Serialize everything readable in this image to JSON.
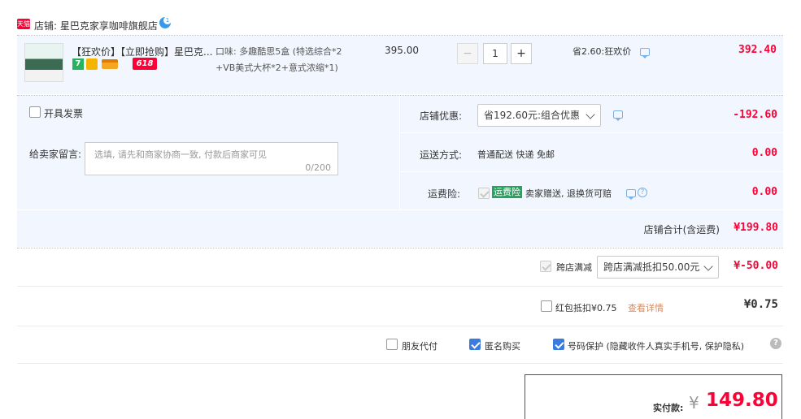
{
  "store": {
    "platform_badge": "天猫",
    "label": "店铺: 星巴克家享咖啡旗舰店",
    "wangwang_badge": "1"
  },
  "item": {
    "title": "【狂欢价】【立即抢购】星巴克...",
    "promo_days_badge": "7",
    "event_badge": "618",
    "flavor_line1": "口味: 多趣酷思5盒 (特选综合*2",
    "flavor_line2": "+VB美式大杯*2+意式浓缩*1)",
    "unit_price": "395.00",
    "minus": "−",
    "quantity": "1",
    "plus": "+",
    "discount": "省2.60:狂欢价",
    "subtotal": "392.40"
  },
  "order_options": {
    "invoice_label": "开具发票",
    "message_label": "给卖家留言:",
    "message_placeholder": "选填, 请先和商家协商一致, 付款后商家可见",
    "message_count": "0/200",
    "store_coupon_label": "店铺优惠:",
    "store_coupon_value": "省192.60元:组合优惠",
    "store_coupon_amount": "-192.60",
    "shipping_label": "运送方式:",
    "shipping_value": "普通配送 快递 免邮",
    "shipping_amount": "0.00",
    "insurance_label": "运费险:",
    "insurance_badge": "运费险",
    "insurance_text": "卖家赠送, 退换货可赔",
    "insurance_amount": "0.00",
    "store_total_label": "店铺合计(含运费)",
    "store_total_value": "¥199.80"
  },
  "cross_store": {
    "label": "跨店满减",
    "select_value": "跨店满减抵扣50.00元",
    "amount": "¥-50.00"
  },
  "red_packet": {
    "label": "红包抵扣¥0.75",
    "link": "查看详情",
    "amount": "¥0.75"
  },
  "extras": {
    "friend_pay": "朋友代付",
    "anonymous": "匿名购买",
    "phone_protect": "号码保护 (隐藏收件人真实手机号, 保护隐私)",
    "help": "?"
  },
  "payment": {
    "label": "实付款:",
    "currency": "¥",
    "amount": "149.80"
  },
  "colors": {
    "accent_red": "#ff0036",
    "panel_blue": "#f2f7ff",
    "check_blue": "#3a7be0"
  }
}
